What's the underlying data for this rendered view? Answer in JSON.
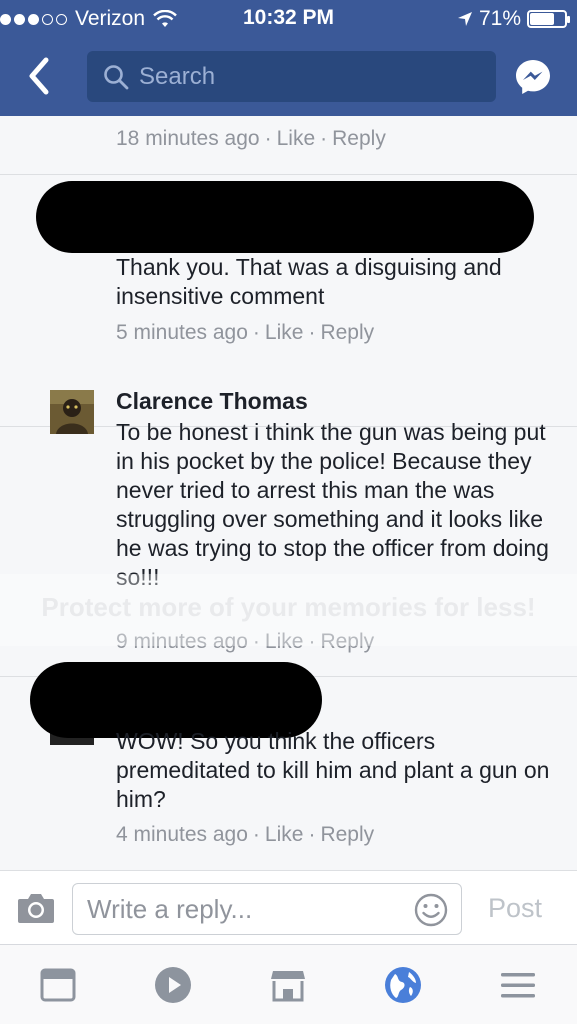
{
  "status_bar": {
    "carrier": "Verizon",
    "time": "10:32 PM",
    "battery_text": "71%",
    "battery_level": 0.71
  },
  "header": {
    "search_placeholder": "Search",
    "icons": [
      "back-icon",
      "search-icon",
      "messenger-icon"
    ]
  },
  "comments": [
    {
      "time": "18 minutes ago",
      "like": "Like",
      "reply": "Reply"
    },
    {
      "text": "Thank you. That was a disguising and insensitive comment",
      "time": "5 minutes ago",
      "like": "Like",
      "reply": "Reply"
    },
    {
      "name": "Clarence Thomas",
      "text": "To be honest i think the gun was being put in his pocket by the police! Because they never tried to arrest this man the was struggling over something and it looks like he was trying to stop the officer from doing so!!!",
      "time": "9 minutes ago",
      "like": "Like",
      "reply": "Reply"
    },
    {
      "text": "WOW! So you think the officers premeditated to kill him and plant a gun on him?",
      "time": "4 minutes ago",
      "like": "Like",
      "reply": "Reply"
    }
  ],
  "watermark": "Protect more of your memories for less!",
  "reply_bar": {
    "placeholder": "Write a reply...",
    "post_label": "Post"
  },
  "tab_bar": {
    "icons": [
      "news-feed-icon",
      "video-icon",
      "marketplace-icon",
      "notifications-globe-icon",
      "menu-icon"
    ],
    "active": "notifications-globe-icon",
    "accent": "#4a7fd9"
  },
  "colors": {
    "header": "#3b5998",
    "search_bg": "#29487d",
    "meta_text": "#90949c"
  }
}
